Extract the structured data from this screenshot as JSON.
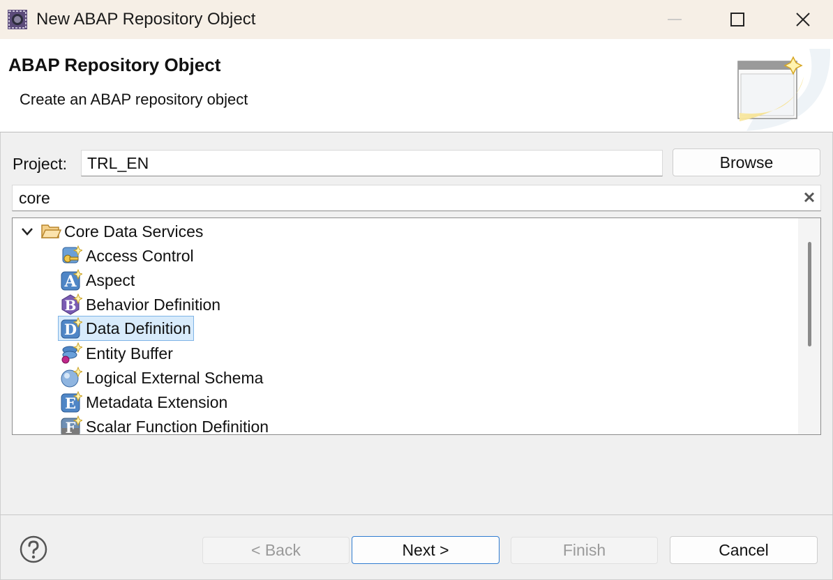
{
  "window": {
    "title": "New ABAP Repository Object"
  },
  "header": {
    "title": "ABAP Repository Object",
    "description": "Create an ABAP repository object"
  },
  "project": {
    "label": "Project:",
    "value": "TRL_EN",
    "browse_label": "Browse"
  },
  "filter": {
    "value": "core"
  },
  "tree": {
    "folder": {
      "label": "Core Data Services",
      "expanded": true,
      "icon": "folder-open-icon"
    },
    "items": [
      {
        "label": "Access Control",
        "icon": "access-control-icon",
        "letter": ""
      },
      {
        "label": "Aspect",
        "icon": "aspect-icon",
        "letter": "A"
      },
      {
        "label": "Behavior Definition",
        "icon": "behavior-definition-icon",
        "letter": "B"
      },
      {
        "label": "Data Definition",
        "icon": "data-definition-icon",
        "letter": "D",
        "selected": true
      },
      {
        "label": "Entity Buffer",
        "icon": "entity-buffer-icon",
        "letter": ""
      },
      {
        "label": "Logical External Schema",
        "icon": "logical-external-schema-icon",
        "letter": ""
      },
      {
        "label": "Metadata Extension",
        "icon": "metadata-extension-icon",
        "letter": "E"
      },
      {
        "label": "Scalar Function Definition",
        "icon": "scalar-function-icon",
        "letter": "F"
      }
    ]
  },
  "footer": {
    "back_label": "< Back",
    "next_label": "Next >",
    "finish_label": "Finish",
    "cancel_label": "Cancel"
  },
  "colors": {
    "titlebar_bg": "#f6efe6",
    "selection_bg": "#d8ebfb",
    "selection_border": "#7fb4e6",
    "default_button_border": "#2f7bd0"
  }
}
